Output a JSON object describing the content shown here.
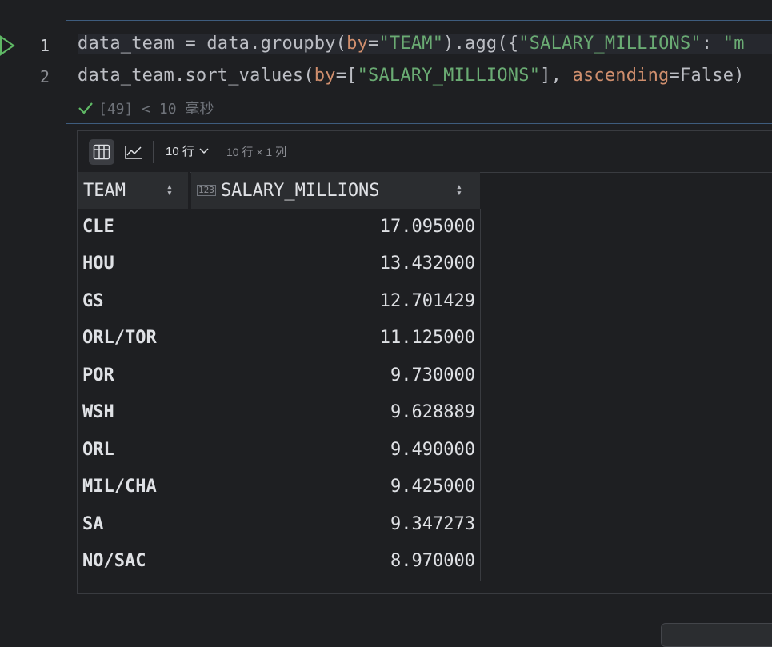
{
  "gutter": {
    "line_numbers": [
      "1",
      "2"
    ]
  },
  "code": {
    "line1": {
      "p1": "data_team = data.groupby(",
      "kw1": "by",
      "p2": "=",
      "s1": "\"TEAM\"",
      "p3": ").agg({",
      "s2": "\"SALARY_MILLIONS\"",
      "p4": ": ",
      "s3": "\"m"
    },
    "line2": {
      "p1": "data_team.sort_values(",
      "kw1": "by",
      "p2": "=[",
      "s1": "\"SALARY_MILLIONS\"",
      "p3": "], ",
      "kw2": "ascending",
      "p4": "=False)"
    },
    "exec_status": "[49] < 10 毫秒"
  },
  "output": {
    "rows_select": "10 行",
    "dims": "10 行 × 1 列",
    "columns": [
      "TEAM",
      "SALARY_MILLIONS"
    ],
    "type_badge": "123",
    "rows": [
      {
        "team": "CLE",
        "salary": "17.095000"
      },
      {
        "team": "HOU",
        "salary": "13.432000"
      },
      {
        "team": "GS",
        "salary": "12.701429"
      },
      {
        "team": "ORL/TOR",
        "salary": "11.125000"
      },
      {
        "team": "POR",
        "salary": "9.730000"
      },
      {
        "team": "WSH",
        "salary": "9.628889"
      },
      {
        "team": "ORL",
        "salary": "9.490000"
      },
      {
        "team": "MIL/CHA",
        "salary": "9.425000"
      },
      {
        "team": "SA",
        "salary": "9.347273"
      },
      {
        "team": "NO/SAC",
        "salary": "8.970000"
      }
    ]
  },
  "colors": {
    "accent_run": "#5fb865",
    "keyword": "#cf8e6d",
    "string": "#6aab73",
    "cell_border": "#3e5c7e"
  },
  "icons": [
    "run-icon",
    "check-icon",
    "table-view-icon",
    "chart-view-icon",
    "chevron-down-icon",
    "sort-icon"
  ]
}
